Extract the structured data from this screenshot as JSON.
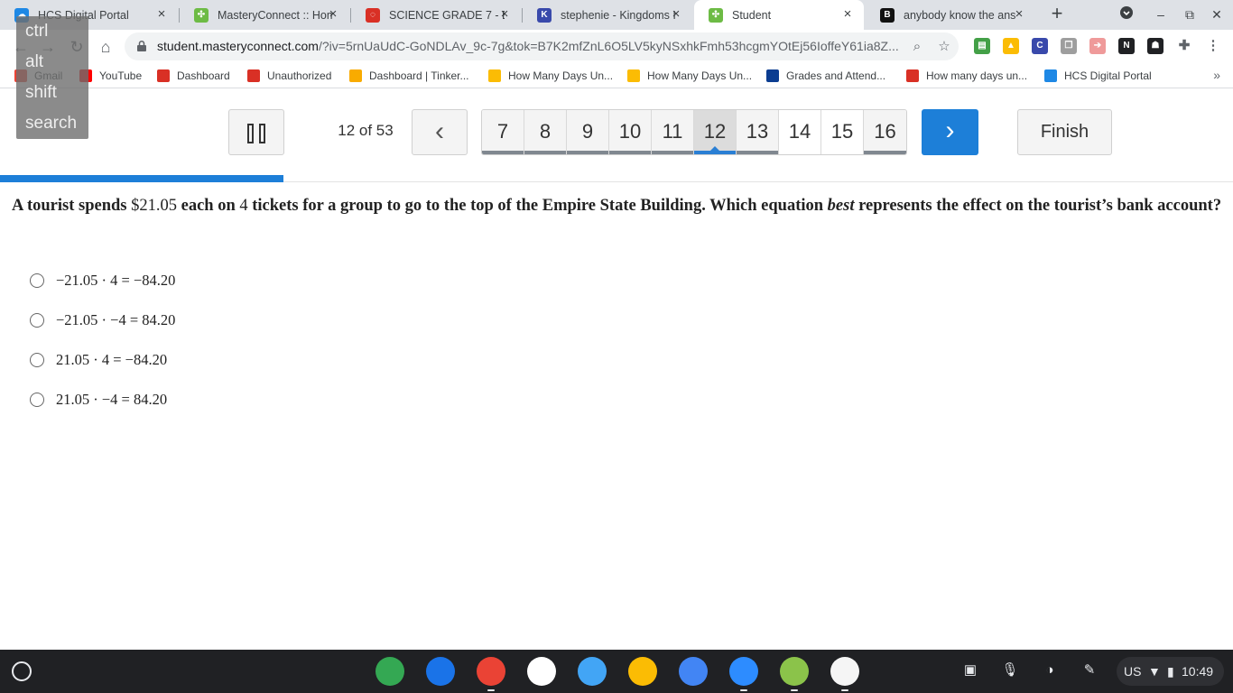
{
  "browser": {
    "tabs": [
      {
        "title": "HCS Digital Portal",
        "fav_color": "#1e88e5",
        "fav_glyph": "☁"
      },
      {
        "title": "MasteryConnect :: Hom",
        "fav_color": "#6dbb45",
        "fav_glyph": "✣"
      },
      {
        "title": "SCIENCE GRADE 7 - Bo",
        "fav_color": "#d93025",
        "fav_glyph": "◌"
      },
      {
        "title": "stephenie - Kingdoms I",
        "fav_color": "#3949ab",
        "fav_glyph": "K"
      },
      {
        "title": "Student",
        "fav_color": "#6dbb45",
        "fav_glyph": "✣"
      },
      {
        "title": "anybody know the ans",
        "fav_color": "#111111",
        "fav_glyph": "B"
      }
    ],
    "active_tab": 4,
    "url_host": "student.masteryconnect.com",
    "url_rest": "/?iv=5rnUaUdC-GoNDLAv_9c-7g&tok=B7K2mfZnL6O5LV5kyNSxhkFmh53hcgmYOtEj56IoffeY61ia8Z...",
    "bookmarks": [
      {
        "label": "Gmail",
        "color": "#ea4335"
      },
      {
        "label": "YouTube",
        "color": "#ff0000"
      },
      {
        "label": "Dashboard",
        "color": "#d93025"
      },
      {
        "label": "Unauthorized",
        "color": "#d93025"
      },
      {
        "label": "Dashboard | Tinker...",
        "color": "#f9ab00"
      },
      {
        "label": "How Many Days Un...",
        "color": "#fbbc04"
      },
      {
        "label": "How Many Days Un...",
        "color": "#fbbc04"
      },
      {
        "label": "Grades and Attend...",
        "color": "#0b3d91"
      },
      {
        "label": "How many days un...",
        "color": "#d93025"
      },
      {
        "label": "HCS Digital Portal",
        "color": "#1e88e5"
      }
    ]
  },
  "keys_overlay": [
    "ctrl",
    "alt",
    "shift",
    "search"
  ],
  "quiz": {
    "counter": "12 of 53",
    "pages": [
      {
        "n": "7",
        "answered": true
      },
      {
        "n": "8",
        "answered": true
      },
      {
        "n": "9",
        "answered": true
      },
      {
        "n": "10",
        "answered": true
      },
      {
        "n": "11",
        "answered": true
      },
      {
        "n": "12",
        "answered": true,
        "current": true
      },
      {
        "n": "13",
        "answered": true
      },
      {
        "n": "14",
        "answered": false
      },
      {
        "n": "15",
        "answered": false
      },
      {
        "n": "16",
        "answered": true
      }
    ],
    "finish_label": "Finish",
    "progress_fraction": 0.23,
    "question": {
      "p1": "A tourist spends ",
      "amount": "$21.05",
      "p2": " each on ",
      "count": "4",
      "p3": " tickets for a group to go to the top of the Empire State Building. Which equation ",
      "emph": "best",
      "p4": " represents the effect on the tourist’s bank account?"
    },
    "choices": [
      "−21.05 · 4 = −84.20",
      "−21.05 · −4 = 84.20",
      "21.05 · 4 = −84.20",
      "21.05 · −4 = 84.20"
    ]
  },
  "shelf": {
    "apps": [
      {
        "name": "play-store",
        "color": "#34a853"
      },
      {
        "name": "camera",
        "color": "#1a73e8"
      },
      {
        "name": "chrome",
        "color": "#ea4335"
      },
      {
        "name": "gmail",
        "color": "#ffffff"
      },
      {
        "name": "cloud",
        "color": "#42a5f5"
      },
      {
        "name": "keep",
        "color": "#fbbc04"
      },
      {
        "name": "docs",
        "color": "#4285f4"
      },
      {
        "name": "zoom",
        "color": "#2d8cff"
      },
      {
        "name": "timer",
        "color": "#8bc34a"
      },
      {
        "name": "masteryconnect",
        "color": "#f5f5f5"
      }
    ],
    "region": "US",
    "time": "10:49"
  }
}
